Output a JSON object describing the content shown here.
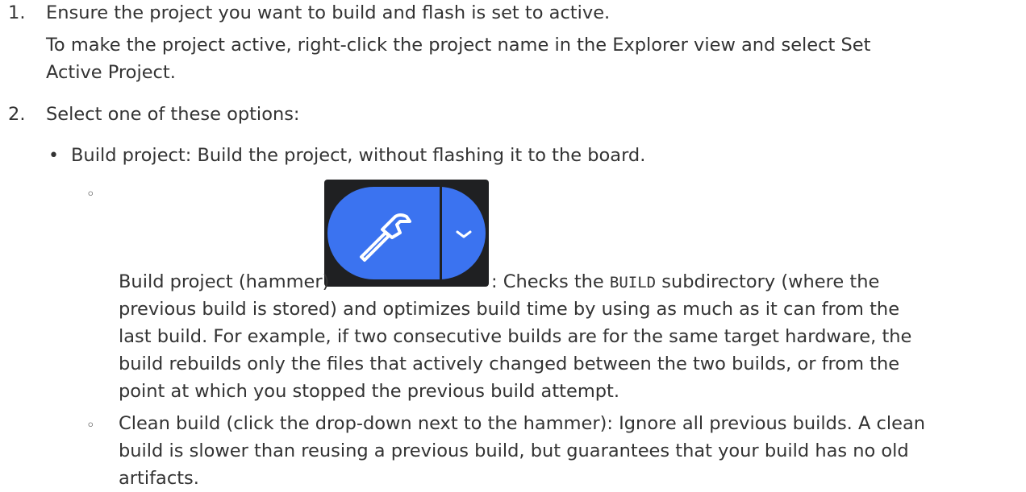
{
  "steps": [
    {
      "number": "1.",
      "lines": [
        "Ensure the project you want to build and flash is set to active.",
        "To make the project active, right-click the project name in the Explorer view and select Set",
        "Active Project."
      ]
    },
    {
      "number": "2.",
      "text": "Select one of these options:"
    }
  ],
  "option_build": {
    "bullet": "•",
    "text": "Build project: Build the project, without flashing it to the board.",
    "sub_bullet": "◦",
    "hammer": {
      "label": "Build project (hammer)",
      "after_image": ": Checks the",
      "code": "BUILD",
      "after_code": "subdirectory (where the",
      "lines": [
        "previous build is stored) and optimizes build time by using as much as it can from the",
        "last build. For example, if two consecutive builds are for the same target hardware, the",
        "build rebuilds only the files that actively changed between the two builds, or from the",
        "point at which you stopped the previous build attempt."
      ],
      "button_icon": "hammer-icon",
      "button_dropdown_icon": "chevron-down-icon",
      "button_colors": {
        "background": "#1f2022",
        "pill": "#3b73f0",
        "icon": "#ffffff"
      }
    },
    "clean": {
      "bullet": "◦",
      "lines": [
        "Clean build (click the drop-down next to the hammer): Ignore all previous builds. A clean",
        "build is slower than reusing a previous build, but guarantees that your build has no old",
        "artifacts."
      ]
    }
  }
}
